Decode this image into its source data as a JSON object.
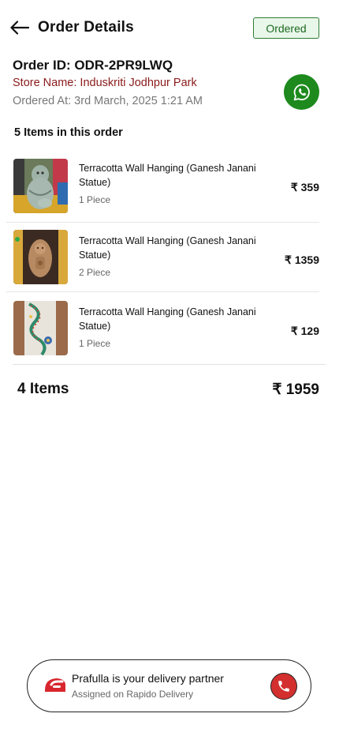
{
  "header": {
    "title": "Order Details",
    "status": "Ordered"
  },
  "order": {
    "id": "Order ID: ODR-2PR9LWQ",
    "store": "Store Name: Induskriti Jodhpur Park",
    "ordered_at": "Ordered At: 3rd March, 2025 1:21 AM"
  },
  "items_heading": "5 Items in this order",
  "items": [
    {
      "name": "Terracotta Wall Hanging (Ganesh Janani Statue)",
      "qty": "1 Piece",
      "price": "₹ 359"
    },
    {
      "name": "Terracotta Wall Hanging (Ganesh Janani Statue)",
      "qty": "2 Piece",
      "price": "₹ 1359"
    },
    {
      "name": "Terracotta Wall Hanging (Ganesh Janani Statue)",
      "qty": "1 Piece",
      "price": "₹ 129"
    }
  ],
  "summary": {
    "count": "4 Items",
    "total": "₹ 1959"
  },
  "delivery": {
    "title": "Prafulla is your delivery partner",
    "subtitle": "Assigned on Rapido Delivery"
  },
  "colors": {
    "status_green": "#2e7d32",
    "whatsapp_green": "#1e8a1e",
    "store_red": "#8b1a1a",
    "call_red": "#d32f2f"
  },
  "icons": {
    "back": "arrow-left-icon",
    "whatsapp": "whatsapp-icon",
    "rapido": "rapido-logo-icon",
    "call": "phone-icon"
  }
}
